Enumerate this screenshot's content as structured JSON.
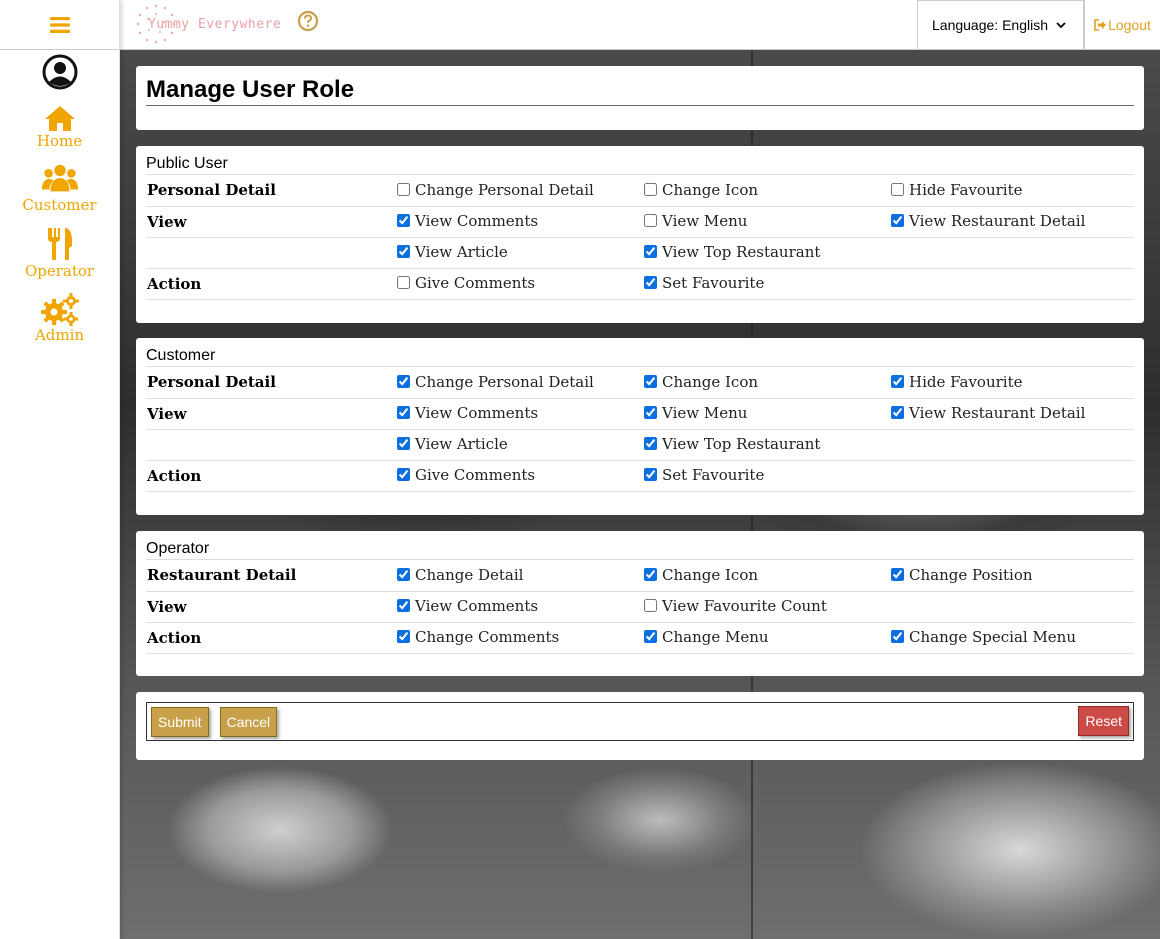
{
  "brand": {
    "name": "Yummy Everywhere"
  },
  "header": {
    "language": "Language: English",
    "logout": "Logout"
  },
  "sidebar": {
    "items": [
      {
        "label": "Home",
        "icon": "home-icon"
      },
      {
        "label": "Customer",
        "icon": "users-icon"
      },
      {
        "label": "Operator",
        "icon": "utensils-icon"
      },
      {
        "label": "Admin",
        "icon": "gears-icon"
      }
    ]
  },
  "colors": {
    "accent": "#f0a500",
    "button": "#c8a04a",
    "reset": "#cc4b46",
    "checkbox": "#0b6fe0"
  },
  "page": {
    "title": "Manage User Role"
  },
  "sections": [
    {
      "title": "Public User",
      "rows": [
        {
          "category": "Personal Detail",
          "options": [
            {
              "label": "Change Personal Detail",
              "checked": false
            },
            {
              "label": "Change Icon",
              "checked": false
            },
            {
              "label": "Hide Favourite",
              "checked": false
            }
          ]
        },
        {
          "category": "View",
          "options": [
            {
              "label": "View Comments",
              "checked": true
            },
            {
              "label": "View Menu",
              "checked": false
            },
            {
              "label": "View Restaurant Detail",
              "checked": true
            }
          ]
        },
        {
          "category": "",
          "options": [
            {
              "label": "View Article",
              "checked": true
            },
            {
              "label": "View Top Restaurant",
              "checked": true
            }
          ]
        },
        {
          "category": "Action",
          "options": [
            {
              "label": "Give Comments",
              "checked": false
            },
            {
              "label": "Set Favourite",
              "checked": true
            }
          ]
        }
      ]
    },
    {
      "title": "Customer",
      "rows": [
        {
          "category": "Personal Detail",
          "options": [
            {
              "label": "Change Personal Detail",
              "checked": true
            },
            {
              "label": "Change Icon",
              "checked": true
            },
            {
              "label": "Hide Favourite",
              "checked": true
            }
          ]
        },
        {
          "category": "View",
          "options": [
            {
              "label": "View Comments",
              "checked": true
            },
            {
              "label": "View Menu",
              "checked": true
            },
            {
              "label": "View Restaurant Detail",
              "checked": true
            }
          ]
        },
        {
          "category": "",
          "options": [
            {
              "label": "View Article",
              "checked": true
            },
            {
              "label": "View Top Restaurant",
              "checked": true
            }
          ]
        },
        {
          "category": "Action",
          "options": [
            {
              "label": "Give Comments",
              "checked": true
            },
            {
              "label": "Set Favourite",
              "checked": true
            }
          ]
        }
      ]
    },
    {
      "title": "Operator",
      "rows": [
        {
          "category": "Restaurant Detail",
          "options": [
            {
              "label": "Change Detail",
              "checked": true
            },
            {
              "label": "Change Icon",
              "checked": true
            },
            {
              "label": "Change Position",
              "checked": true
            }
          ]
        },
        {
          "category": "View",
          "options": [
            {
              "label": "View Comments",
              "checked": true
            },
            {
              "label": "View Favourite Count",
              "checked": false
            }
          ]
        },
        {
          "category": "Action",
          "options": [
            {
              "label": "Change Comments",
              "checked": true
            },
            {
              "label": "Change Menu",
              "checked": true
            },
            {
              "label": "Change Special Menu",
              "checked": true
            }
          ]
        }
      ]
    }
  ],
  "actions": {
    "submit": "Submit",
    "cancel": "Cancel",
    "reset": "Reset"
  }
}
